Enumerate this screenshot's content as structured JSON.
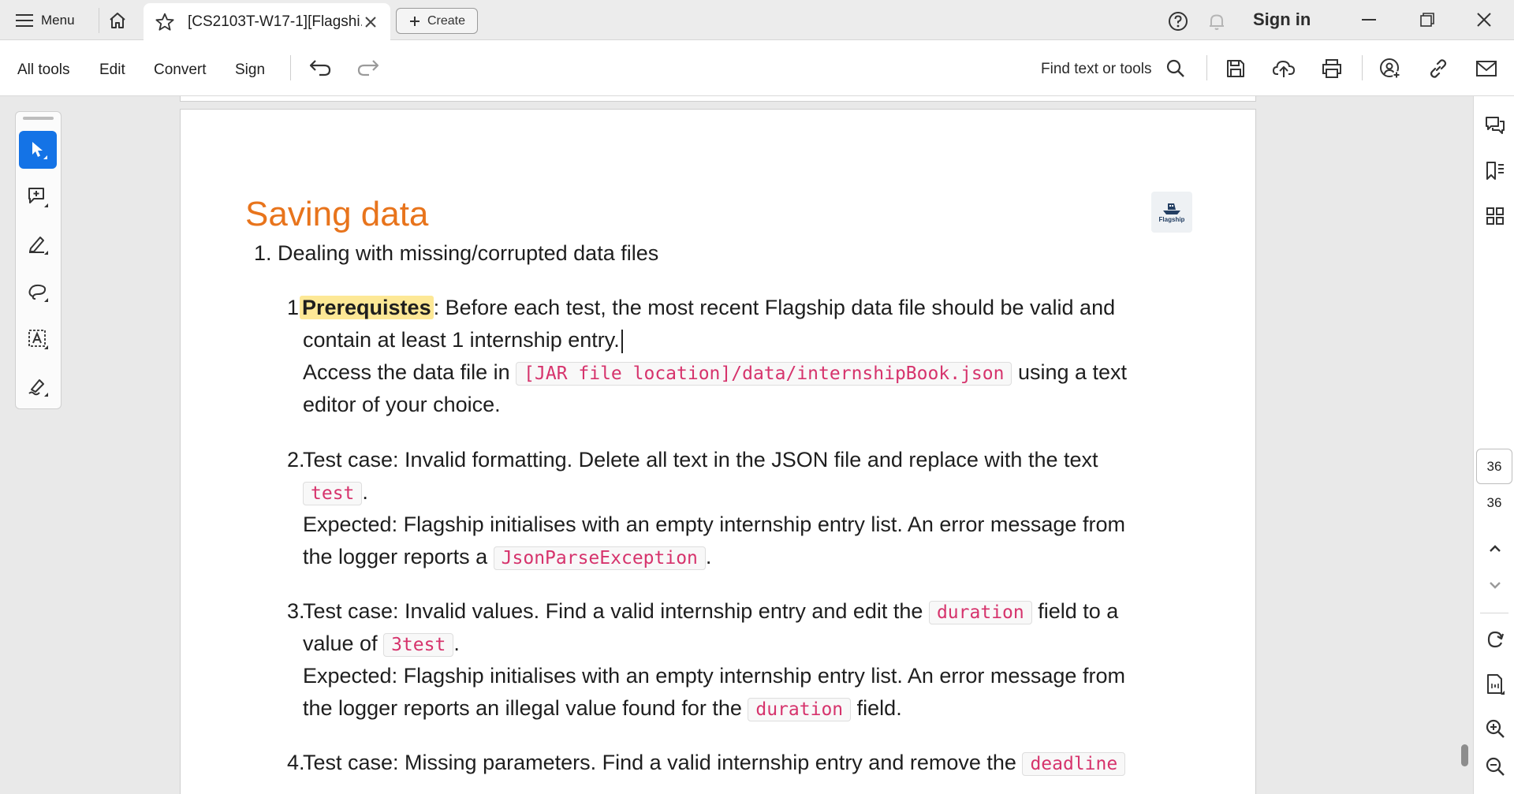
{
  "titlebar": {
    "menu_label": "Menu",
    "tab_title": "[CS2103T-W17-1][Flagshi...",
    "create_label": "Create",
    "signin_label": "Sign in"
  },
  "toolbar": {
    "all_tools": "All tools",
    "edit": "Edit",
    "convert": "Convert",
    "sign": "Sign",
    "find_placeholder": "Find text or tools"
  },
  "document": {
    "title": "Saving data",
    "logo_text": "Flagship",
    "section_number": "1.",
    "section_heading": "Dealing with missing/corrupted data files",
    "items": [
      {
        "number": "1.",
        "highlight": "Prerequistes",
        "line1_rest": ": Before each test, the most recent Flagship data file should be valid and",
        "line2": "contain at least 1 internship entry.",
        "line3_pre": "Access the data file in ",
        "line3_code": "[JAR file location]/data/internshipBook.json",
        "line3_post": " using a text",
        "line4": "editor of your choice."
      },
      {
        "number": "2.",
        "line1": "Test case: Invalid formatting. Delete all text in the JSON file and replace with the text",
        "line2_code": "test",
        "line2_post": ".",
        "line3": "Expected: Flagship initialises with an empty internship entry list. An error message from",
        "line4_pre": "the logger reports a ",
        "line4_code": "JsonParseException",
        "line4_post": "."
      },
      {
        "number": "3.",
        "line1_pre": "Test case: Invalid values. Find a valid internship entry and edit the ",
        "line1_code": "duration",
        "line1_post": " field to a",
        "line2_pre": "value of ",
        "line2_code": "3test",
        "line2_post": ".",
        "line3": "Expected: Flagship initialises with an empty internship entry list. An error message from",
        "line4_pre": "the logger reports an illegal value found for the ",
        "line4_code": "duration",
        "line4_post": " field."
      },
      {
        "number": "4.",
        "line1_pre": "Test case: Missing parameters. Find a valid internship entry and remove the ",
        "line1_code": "deadline"
      }
    ]
  },
  "pager": {
    "current_page": "36",
    "total_pages": "36"
  },
  "colors": {
    "title_orange": "#e8741c",
    "code_pink": "#d6336c",
    "highlight_yellow": "#fde896",
    "accent_blue": "#1473e6"
  }
}
